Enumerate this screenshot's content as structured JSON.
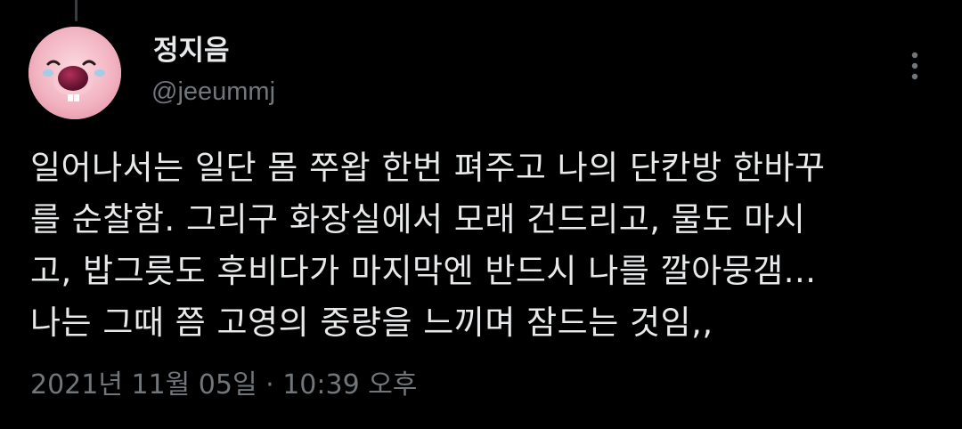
{
  "user": {
    "display_name": "정지음",
    "handle": "@jeeummj",
    "avatar_icon": "pink-character-avatar"
  },
  "tweet": {
    "lines": [
      "일어나서는 일단 몸 쭈왑 한번 펴주고 나의 단칸방 한바꾸",
      "를 순찰함. 그리구 화장실에서 모래 건드리고, 물도 마시",
      "고, 밥그릇도 후비다가 마지막엔 반드시 나를 깔아뭉갬...",
      "나는 그때 쯤 고영의 중량을 느끼며 잠드는 것임,,"
    ]
  },
  "meta": {
    "date": "2021년 11월 05일",
    "separator": "·",
    "time": "10:39 오후"
  },
  "icons": {
    "more": "more-vertical-icon"
  },
  "colors": {
    "background": "#000000",
    "primary_text": "#e7e9ea",
    "secondary_text": "#71767b"
  }
}
